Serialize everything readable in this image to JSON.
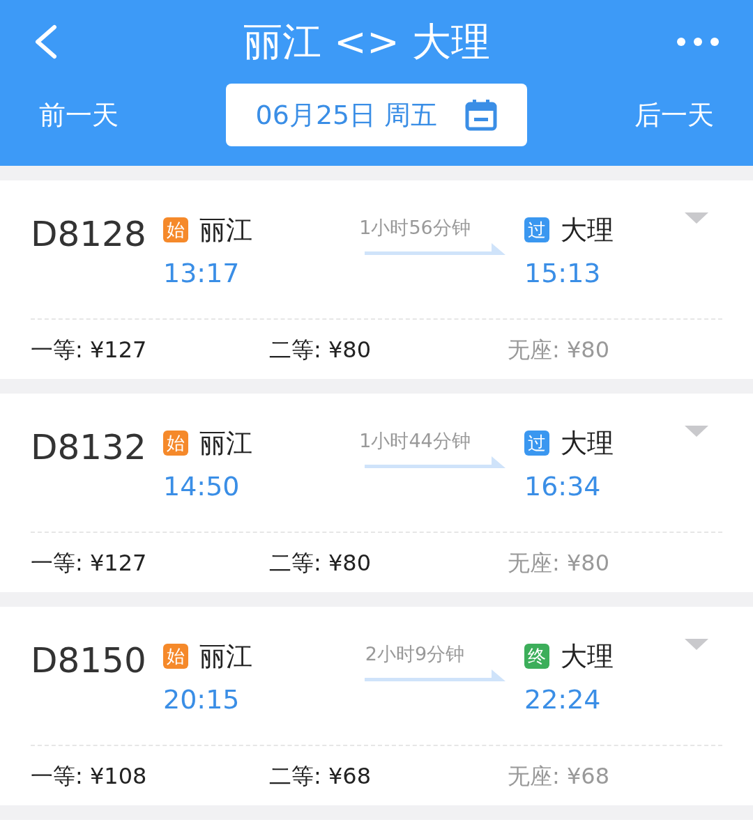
{
  "header": {
    "title": "丽江 <> 大理"
  },
  "date_nav": {
    "prev": "前一天",
    "date": "06月25日 周五",
    "next": "后一天"
  },
  "trains": [
    {
      "number": "D8128",
      "from": {
        "badge": "始",
        "color": "#f5892a",
        "name": "丽江",
        "time": "13:17"
      },
      "duration": "1小时56分钟",
      "to": {
        "badge": "过",
        "color": "#3a97f0",
        "name": "大理",
        "time": "15:13"
      },
      "prices": [
        {
          "label": "一等:",
          "value": "¥127",
          "available": true
        },
        {
          "label": "二等:",
          "value": "¥80",
          "available": true
        },
        {
          "label": "无座:",
          "value": "¥80",
          "available": false
        }
      ]
    },
    {
      "number": "D8132",
      "from": {
        "badge": "始",
        "color": "#f5892a",
        "name": "丽江",
        "time": "14:50"
      },
      "duration": "1小时44分钟",
      "to": {
        "badge": "过",
        "color": "#3a97f0",
        "name": "大理",
        "time": "16:34"
      },
      "prices": [
        {
          "label": "一等:",
          "value": "¥127",
          "available": true
        },
        {
          "label": "二等:",
          "value": "¥80",
          "available": true
        },
        {
          "label": "无座:",
          "value": "¥80",
          "available": false
        }
      ]
    },
    {
      "number": "D8150",
      "from": {
        "badge": "始",
        "color": "#f5892a",
        "name": "丽江",
        "time": "20:15"
      },
      "duration": "2小时9分钟",
      "to": {
        "badge": "终",
        "color": "#3cae5a",
        "name": "大理",
        "time": "22:24"
      },
      "prices": [
        {
          "label": "一等:",
          "value": "¥108",
          "available": true
        },
        {
          "label": "二等:",
          "value": "¥68",
          "available": true
        },
        {
          "label": "无座:",
          "value": "¥68",
          "available": false
        }
      ]
    }
  ]
}
